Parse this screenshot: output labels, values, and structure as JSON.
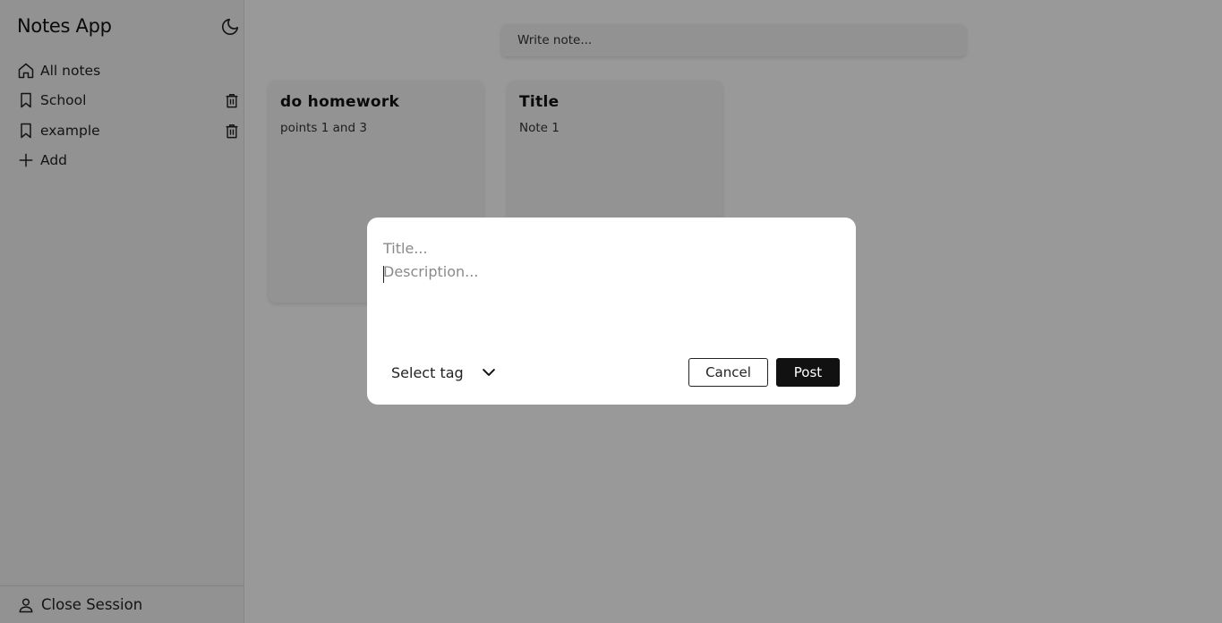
{
  "app": {
    "title": "Notes App"
  },
  "sidebar": {
    "items": [
      {
        "label": "All notes",
        "icon": "home-icon",
        "deletable": false
      },
      {
        "label": "School",
        "icon": "bookmark-icon",
        "deletable": true
      },
      {
        "label": "example",
        "icon": "bookmark-icon",
        "deletable": true
      },
      {
        "label": "Add",
        "icon": "plus-icon",
        "deletable": false
      }
    ],
    "footer": {
      "label": "Close Session",
      "icon": "user-icon"
    },
    "theme_icon": "moon-icon"
  },
  "search": {
    "placeholder": "Write note..."
  },
  "notes": [
    {
      "title": "do homework",
      "body": "points 1 and 3"
    },
    {
      "title": "Title",
      "body": "Note 1"
    }
  ],
  "modal": {
    "title_placeholder": "Title...",
    "description_placeholder": "Description...",
    "tag_select_label": "Select tag",
    "cancel_label": "Cancel",
    "post_label": "Post"
  },
  "colors": {
    "overlay": "rgba(0,0,0,0.40)",
    "primary_button": "#111111",
    "sidebar_bg": "#f4f4f4"
  }
}
